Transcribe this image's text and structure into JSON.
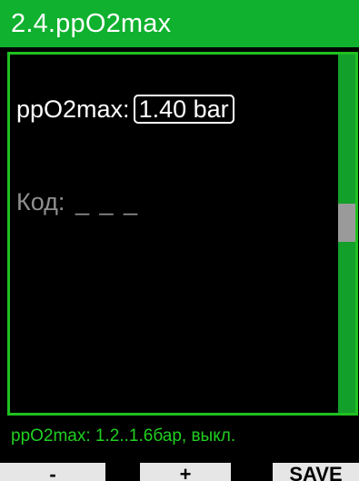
{
  "header": {
    "title": "2.4.ppO2max"
  },
  "setting": {
    "label": "ppO2max:",
    "value": "1.40 bar"
  },
  "code": {
    "label": "Код:",
    "value": "_ _ _"
  },
  "hint": {
    "text": "ppO2max: 1.2..1.6бар, выкл."
  },
  "softkeys": {
    "left": "-",
    "middle": "+",
    "right": "SAVE"
  },
  "colors": {
    "accent_green": "#0fb12e",
    "hint_green": "#21d021",
    "background": "#000000"
  }
}
